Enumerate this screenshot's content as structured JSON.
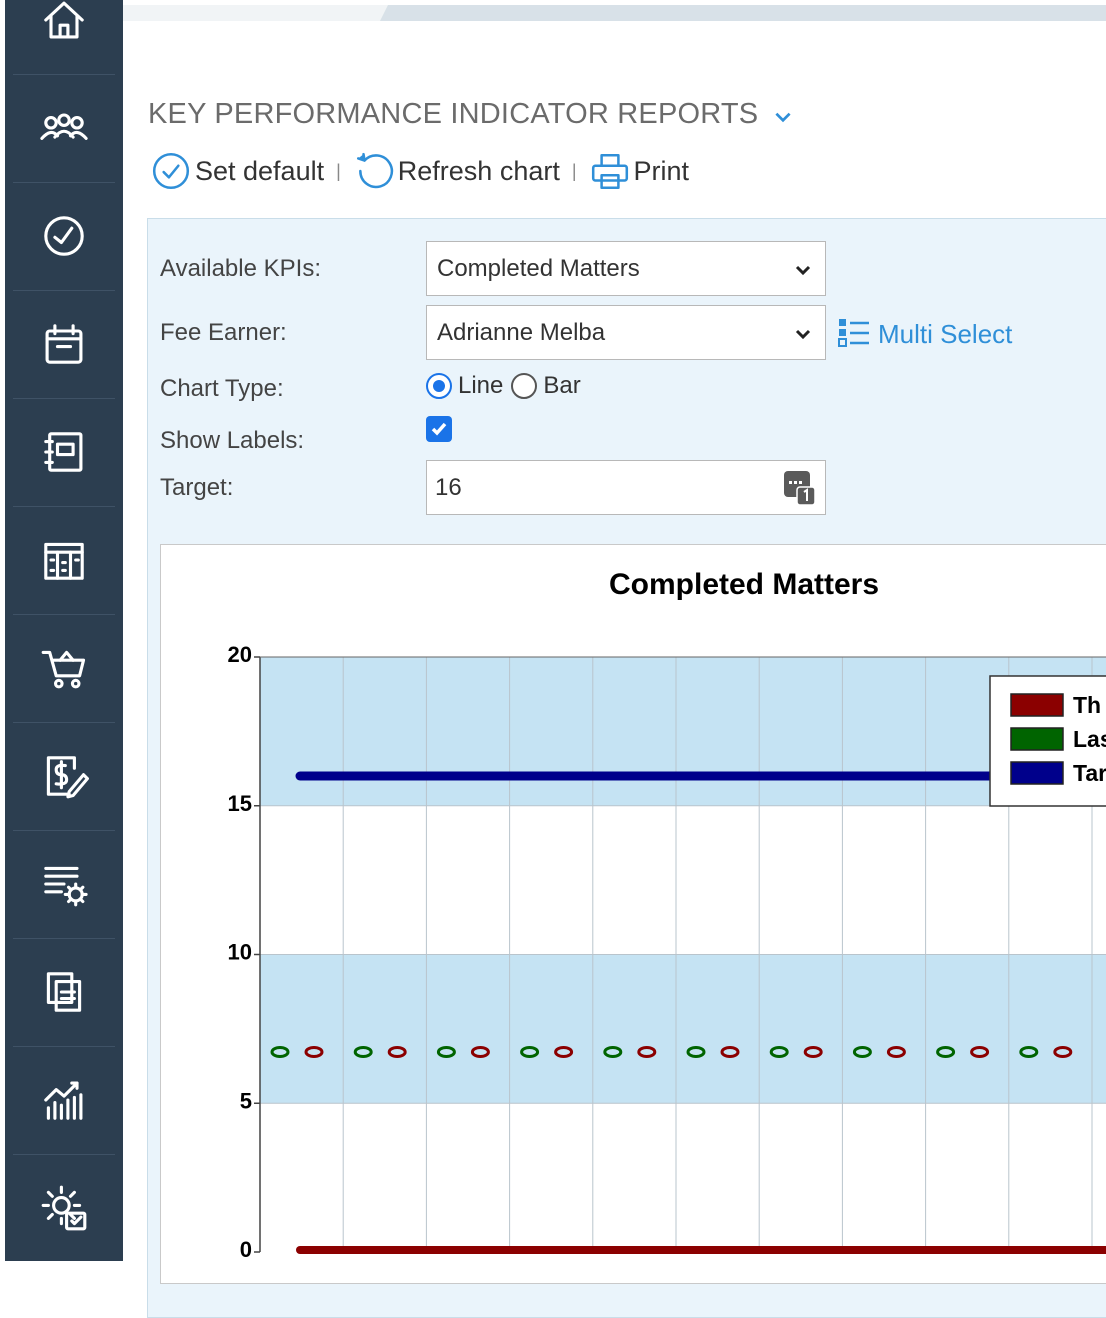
{
  "header": {
    "title": "KEY PERFORMANCE INDICATOR REPORTS"
  },
  "toolbar": {
    "set_default": "Set default",
    "refresh": "Refresh chart",
    "print": "Print",
    "separator": "|"
  },
  "sidebar": {
    "items": [
      {
        "icon": "home-icon"
      },
      {
        "icon": "contacts-icon"
      },
      {
        "icon": "clock-icon"
      },
      {
        "icon": "calendar-icon"
      },
      {
        "icon": "notebook-icon"
      },
      {
        "icon": "board-icon"
      },
      {
        "icon": "cart-icon"
      },
      {
        "icon": "billing-icon"
      },
      {
        "icon": "settings-list-icon"
      },
      {
        "icon": "documents-icon"
      },
      {
        "icon": "analytics-icon"
      },
      {
        "icon": "admin-settings-icon"
      }
    ]
  },
  "form": {
    "kpi_label": "Available KPIs:",
    "kpi_value": "Completed Matters",
    "fee_earner_label": "Fee Earner:",
    "fee_earner_value": "Adrianne Melba",
    "multi_select": "Multi Select",
    "chart_type_label": "Chart Type:",
    "chart_type_line": "Line",
    "chart_type_bar": "Bar",
    "chart_type_selected": "Line",
    "show_labels_label": "Show Labels:",
    "show_labels_checked": true,
    "target_label": "Target:",
    "target_value": "16"
  },
  "chart_data": {
    "type": "line",
    "title": "Completed Matters",
    "ylim": [
      0,
      20
    ],
    "yticks": [
      "0",
      "5",
      "10",
      "15",
      "20"
    ],
    "legend_position": "top-right",
    "legend": [
      "Th",
      "Las",
      "Tar"
    ],
    "series": [
      {
        "color": "#8b0000",
        "values": [
          0,
          0,
          0,
          0,
          0,
          0,
          0,
          0,
          0,
          0
        ]
      },
      {
        "color": "#006400",
        "values": [
          0,
          0,
          0,
          0,
          0,
          0,
          0,
          0,
          0,
          0
        ]
      },
      {
        "color": "#00008b",
        "values": [
          16,
          16,
          16,
          16,
          16,
          16,
          16,
          16,
          16,
          16
        ]
      }
    ],
    "grid": true,
    "colors": {
      "band": "#c5e3f3",
      "plot_bg": "#ffffff"
    }
  }
}
